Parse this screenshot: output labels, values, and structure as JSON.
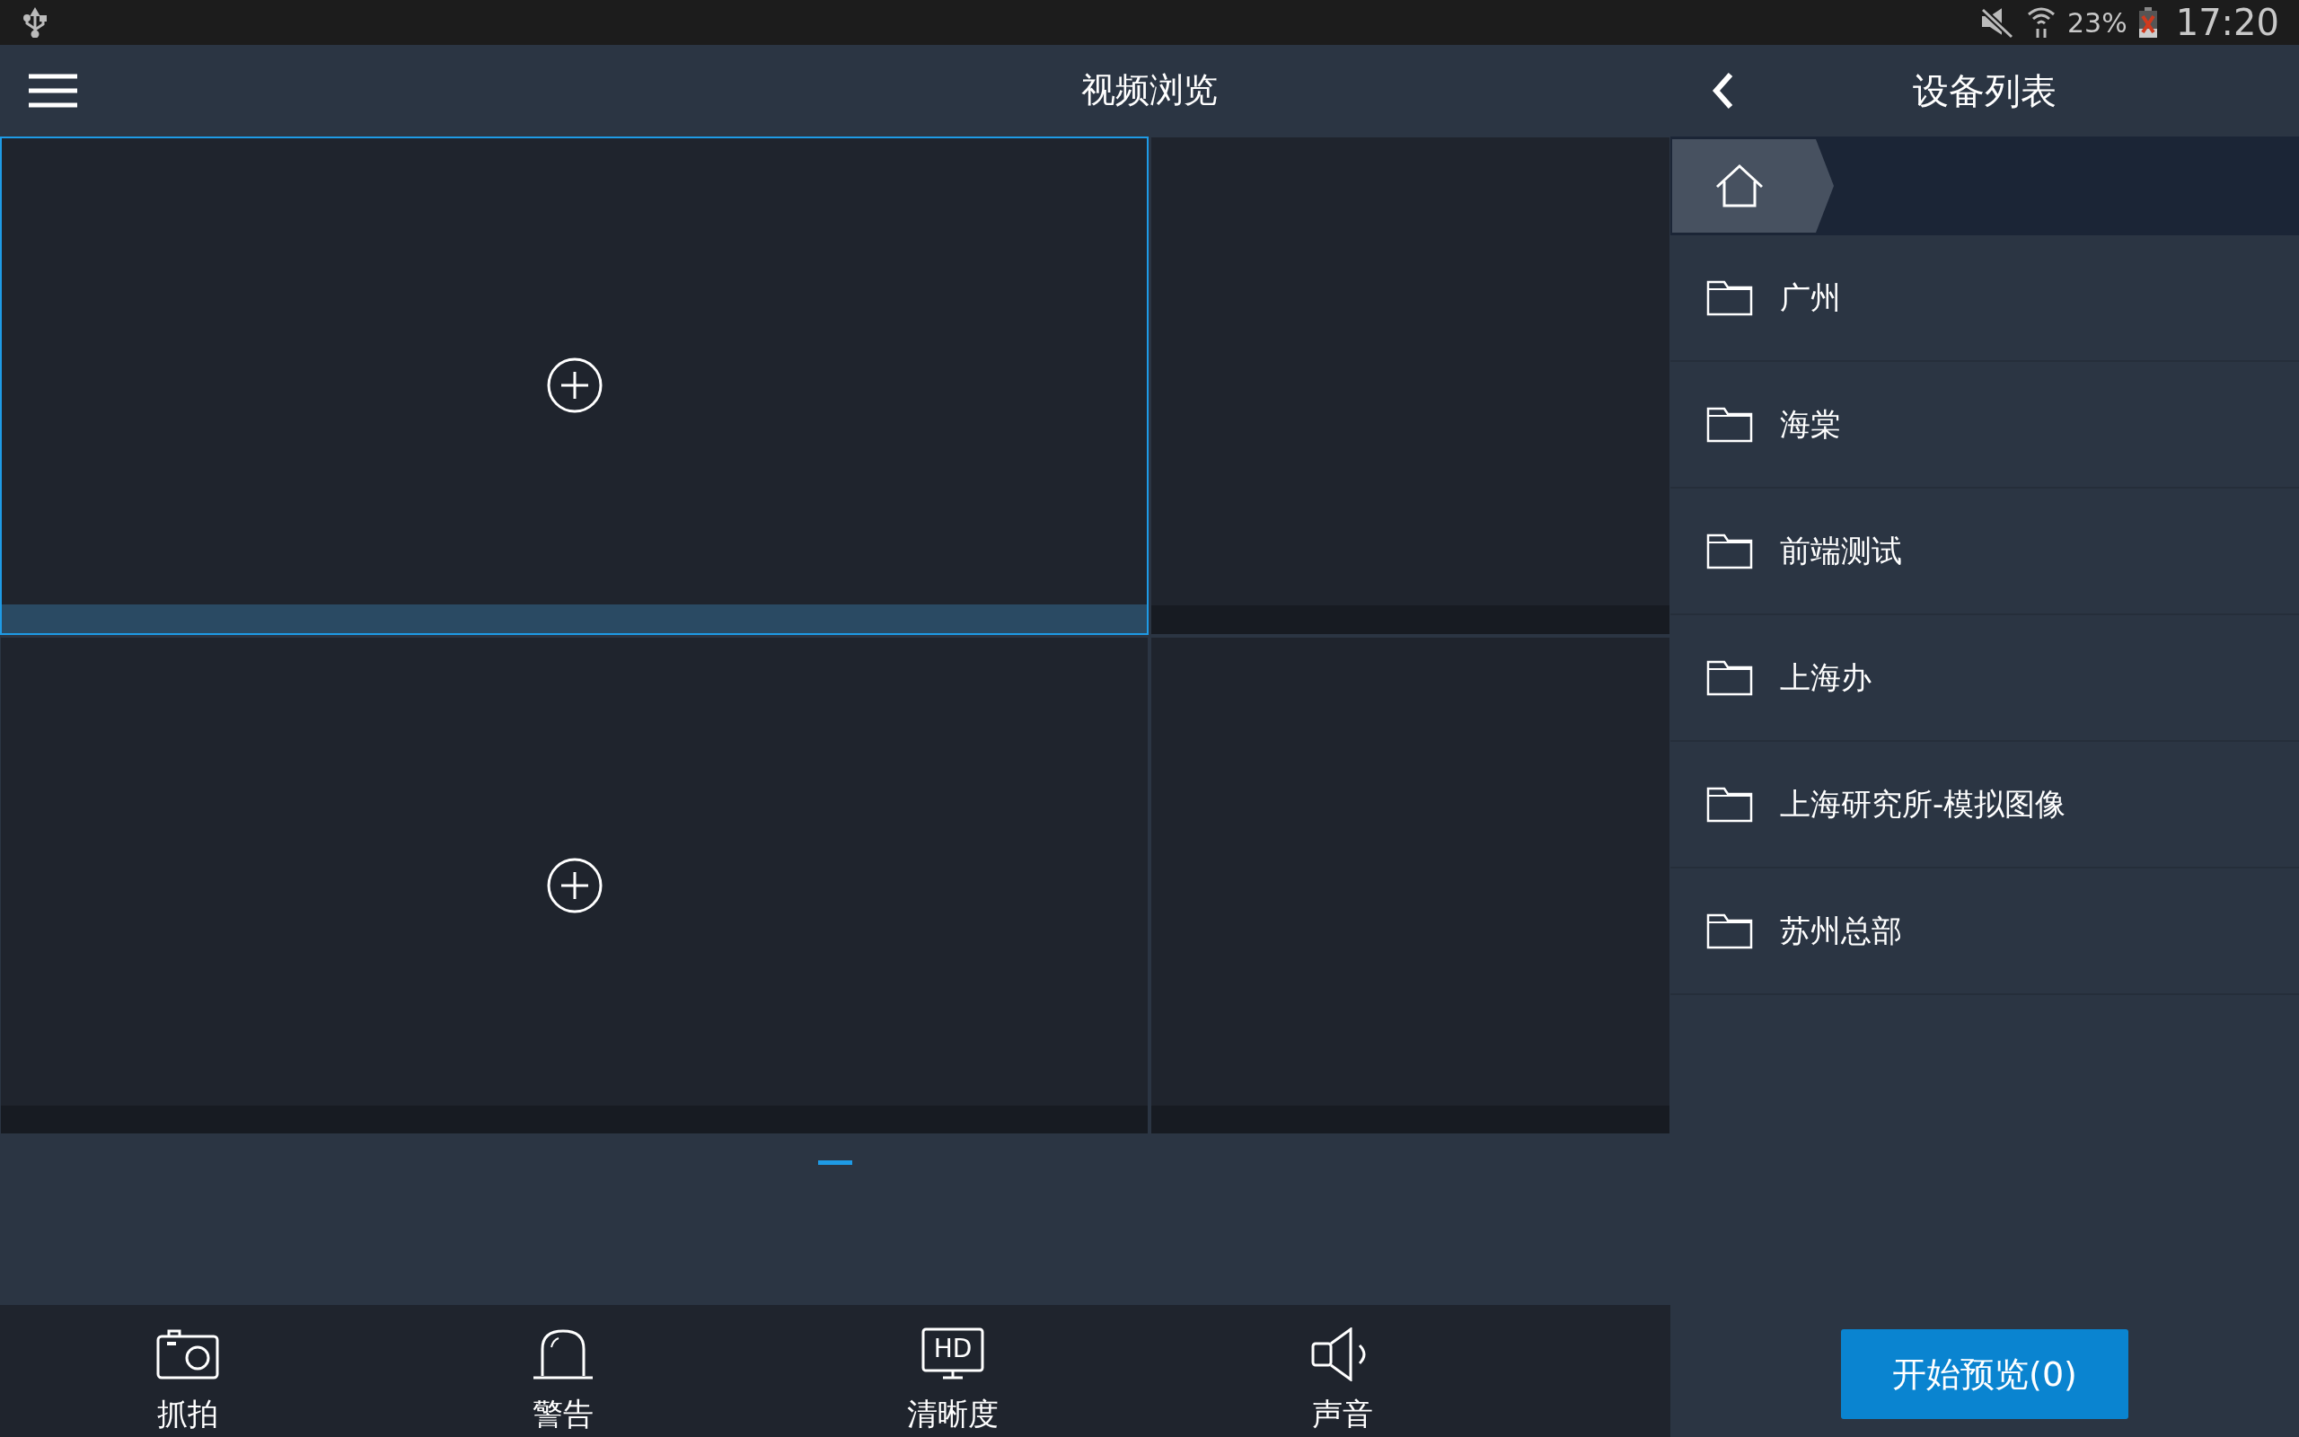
{
  "status_bar": {
    "battery": "23%",
    "time": "17:20"
  },
  "header": {
    "title": "视频浏览"
  },
  "cells": [
    {
      "selected": true,
      "add": true
    },
    {
      "selected": false,
      "add": false
    },
    {
      "selected": false,
      "add": true
    },
    {
      "selected": false,
      "add": false
    }
  ],
  "toolbar": [
    {
      "kind": "camera",
      "label": "抓拍"
    },
    {
      "kind": "alarm",
      "label": "警告"
    },
    {
      "kind": "hd",
      "icon_text": "HD",
      "label": "清晰度"
    },
    {
      "kind": "speaker",
      "label": "声音"
    }
  ],
  "device_panel": {
    "title": "设备列表",
    "folders": [
      {
        "name": "广州"
      },
      {
        "name": "海棠"
      },
      {
        "name": "前端测试"
      },
      {
        "name": "上海办"
      },
      {
        "name": "上海研究所-模拟图像"
      },
      {
        "name": "苏州总部"
      }
    ],
    "button": "开始预览(0)"
  }
}
